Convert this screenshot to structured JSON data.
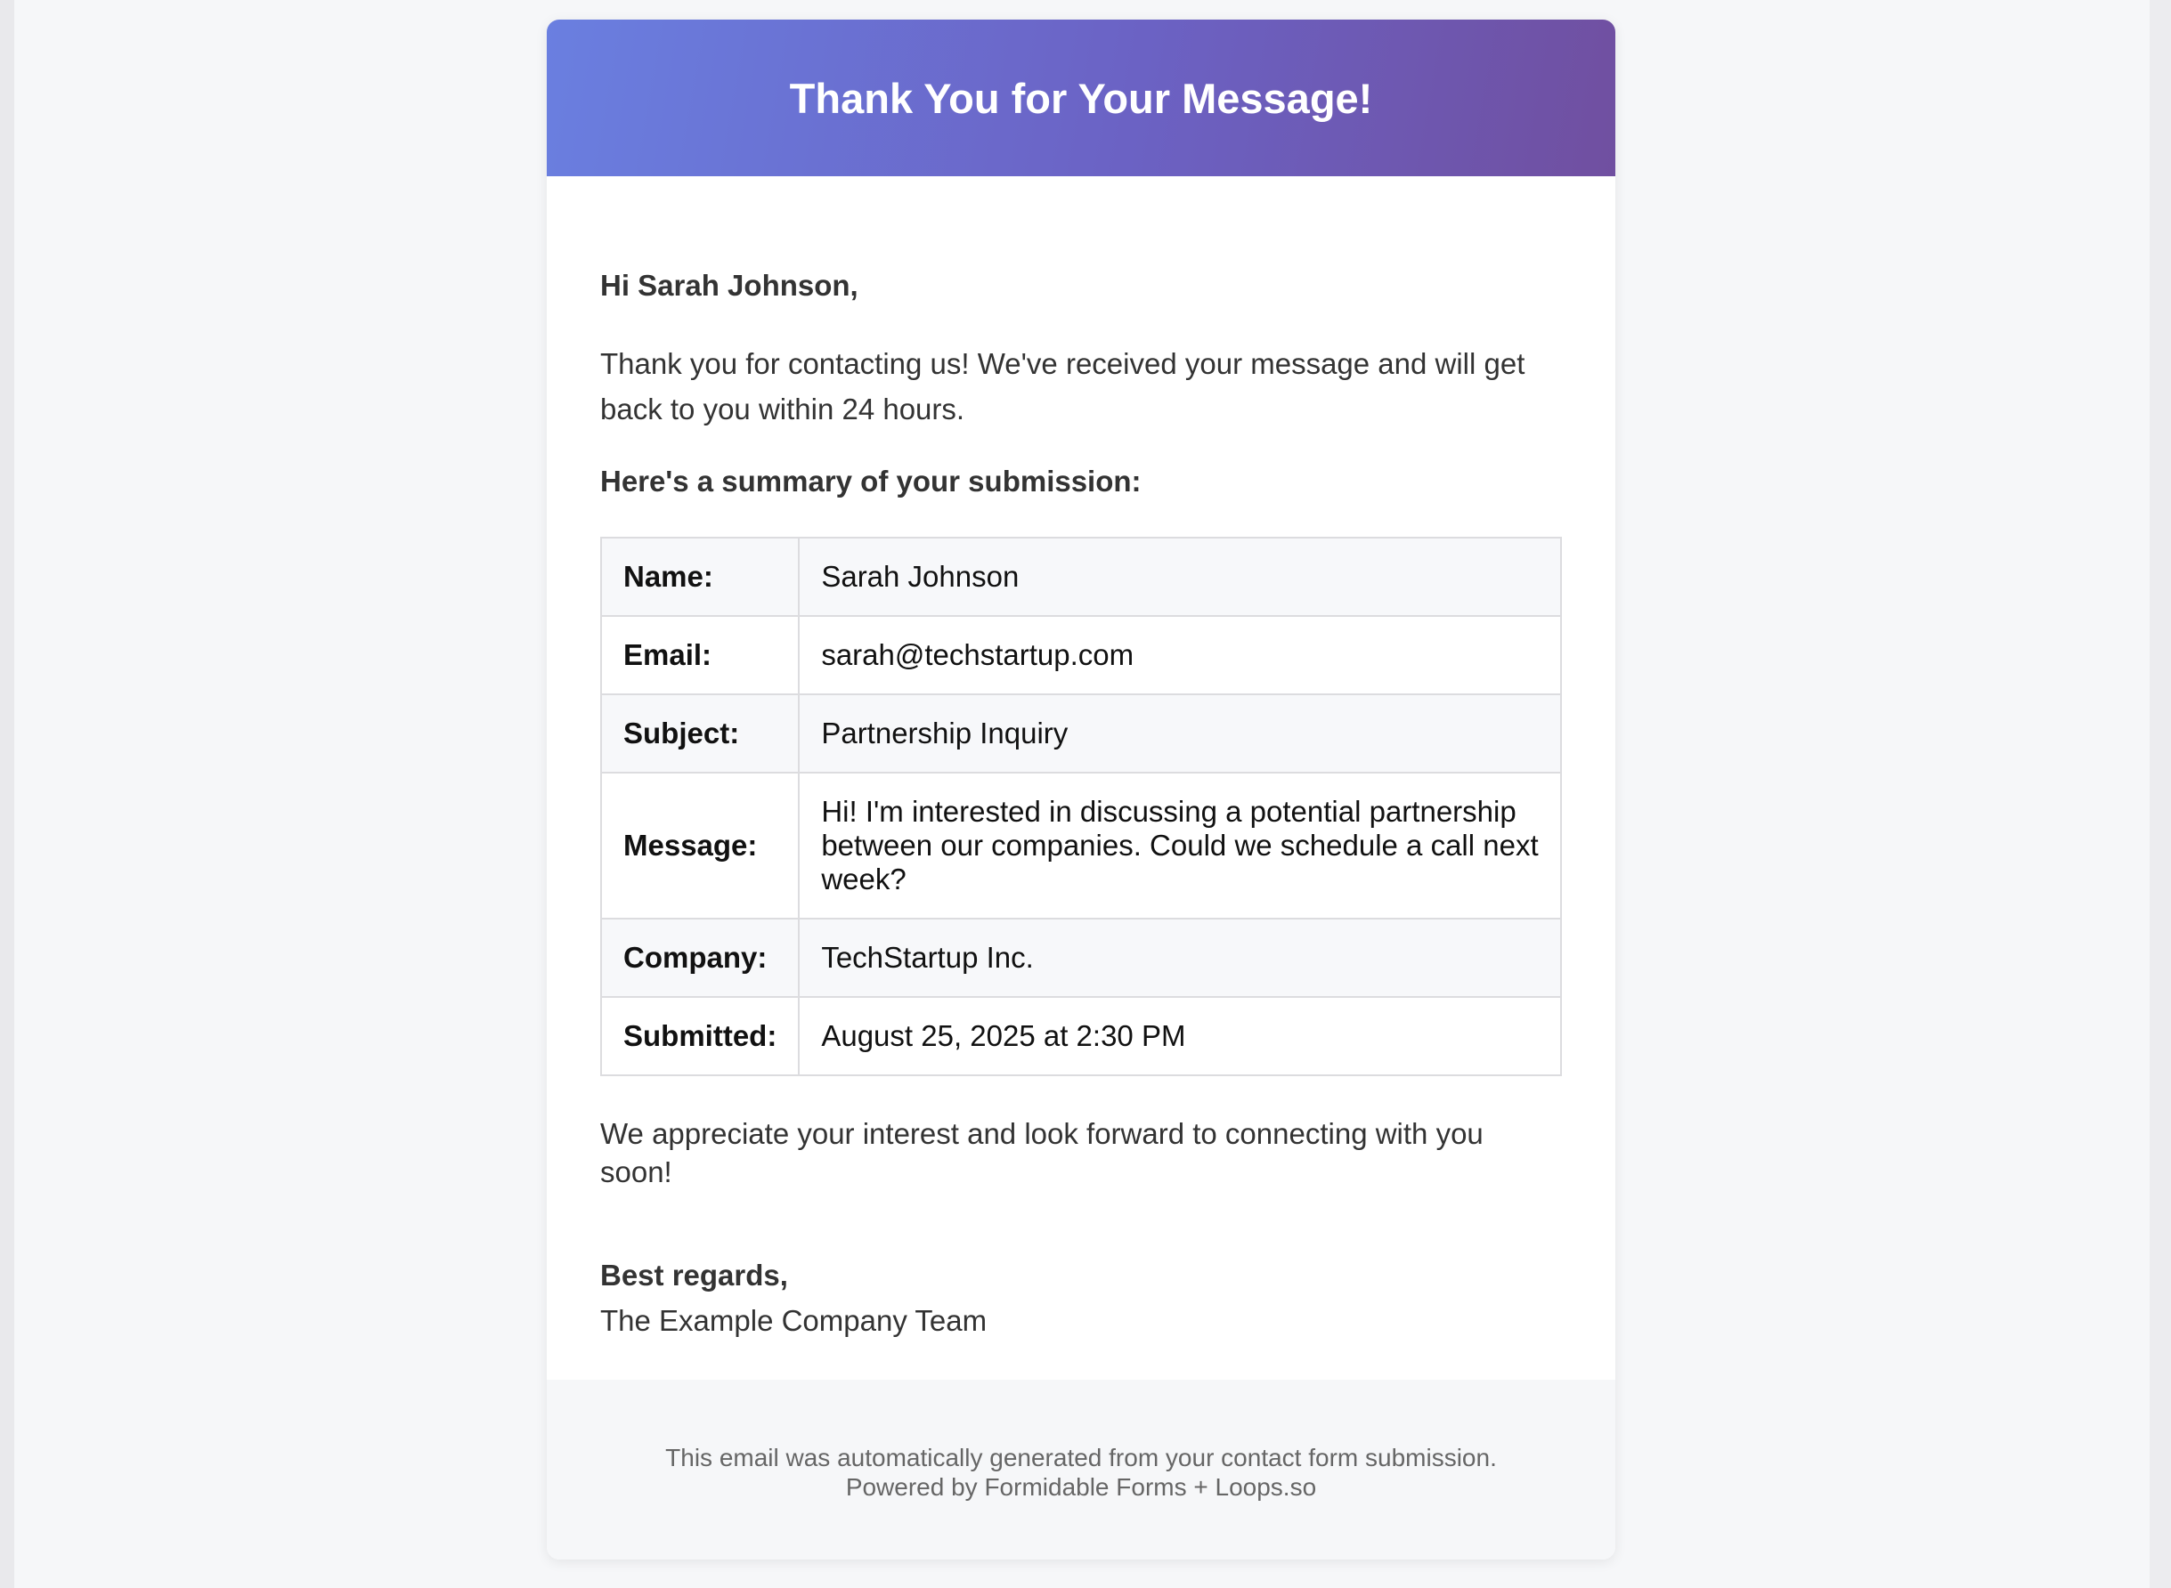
{
  "header": {
    "title": "Thank You for Your Message!"
  },
  "body": {
    "greeting": "Hi Sarah Johnson,",
    "intro": "Thank you for contacting us! We've received your message and will get back to you within 24 hours.",
    "summary_heading": "Here's a summary of your submission:",
    "summary_rows": [
      {
        "label": "Name:",
        "value": "Sarah Johnson"
      },
      {
        "label": "Email:",
        "value": "sarah@techstartup.com"
      },
      {
        "label": "Subject:",
        "value": "Partnership Inquiry"
      },
      {
        "label": "Message:",
        "value": "Hi! I'm interested in discussing a potential partnership between our companies. Could we schedule a call next week?"
      },
      {
        "label": "Company:",
        "value": "TechStartup Inc."
      },
      {
        "label": "Submitted:",
        "value": "August 25, 2025 at 2:30 PM"
      }
    ],
    "closing": "We appreciate your interest and look forward to connecting with you soon!",
    "signoff": "Best regards,",
    "team": "The Example Company Team"
  },
  "footer": {
    "line1": "This email was automatically generated from your contact form submission.",
    "line2": "Powered by Formidable Forms + Loops.so"
  },
  "colors": {
    "header_gradient_start": "#6a7fe0",
    "header_gradient_end": "#704fa0",
    "page_background": "#f6f7f9",
    "card_background": "#ffffff",
    "text": "#333333",
    "footer_text": "#666666"
  }
}
